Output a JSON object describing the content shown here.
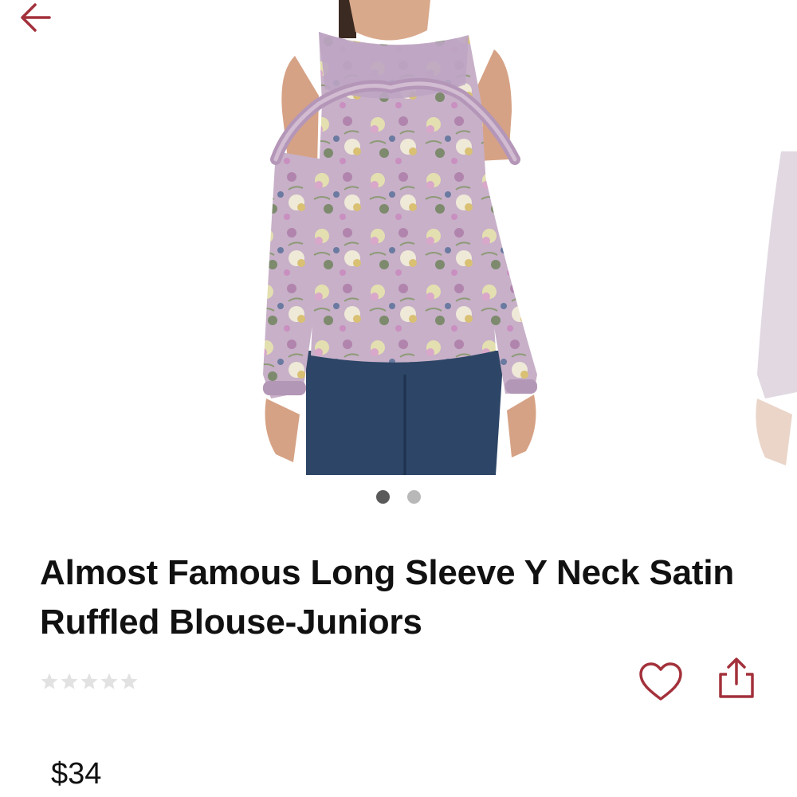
{
  "header": {
    "back_icon": "arrow-left-icon"
  },
  "colors": {
    "accent": "#a3313b",
    "star_empty": "#e2e2e2",
    "dot_active": "#5a5a5a",
    "dot_inactive": "#b8b8b8"
  },
  "gallery": {
    "image_count": 2,
    "active_index": 0
  },
  "product": {
    "title": "Almost Famous Long Sleeve Y Neck Satin Ruffled Blouse-Juniors",
    "rating": 0,
    "rating_max": 5,
    "price": "$34"
  },
  "actions": {
    "favorite_icon": "heart-icon",
    "share_icon": "share-icon"
  }
}
